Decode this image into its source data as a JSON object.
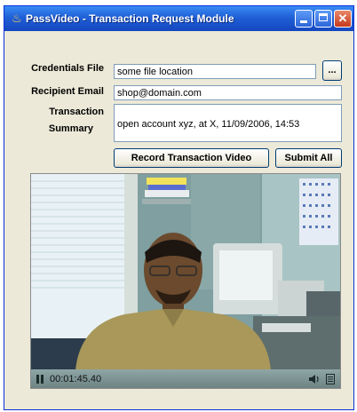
{
  "window": {
    "title": "PassVideo - Transaction Request Module",
    "icon": "java-cup-icon",
    "controls": [
      "minimize-icon",
      "maximize-icon",
      "close-icon"
    ]
  },
  "form": {
    "credentials_label": "Credentials File",
    "credentials_value": "some file location",
    "browse_label": "...",
    "recipient_label": "Recipient Email",
    "recipient_value": "shop@domain.com",
    "summary_label_line1": "Transaction",
    "summary_label_line2": "Summary",
    "summary_value": "open account xyz, at X, 11/09/2006, 14:53"
  },
  "buttons": {
    "record_label": "Record Transaction Video",
    "submit_label": "Submit All"
  },
  "video": {
    "timecode": "00:01:45.40",
    "state": "paused",
    "controls": [
      "pause-icon",
      "volume-icon",
      "playlist-icon"
    ]
  },
  "colors": {
    "titlebar": "#1f5fd6",
    "window_bg": "#ece9d8",
    "field_border": "#7f9db9"
  }
}
